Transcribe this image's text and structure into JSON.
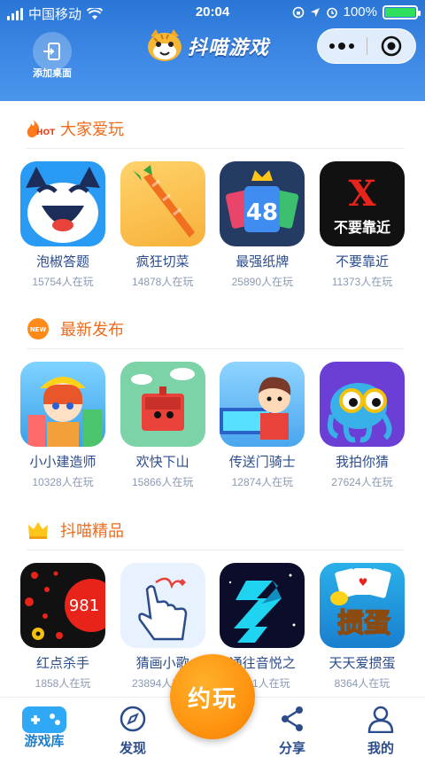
{
  "status_bar": {
    "carrier": "中国移动",
    "time": "20:04",
    "battery": "100%"
  },
  "header": {
    "add_desktop": "添加桌面",
    "brand": "抖喵游戏"
  },
  "sections": [
    {
      "title": "大家爱玩",
      "badge": "HOT",
      "games": [
        {
          "name": "泡椒答题",
          "players": "15754人在玩"
        },
        {
          "name": "疯狂切菜",
          "players": "14878人在玩"
        },
        {
          "name": "最强纸牌",
          "players": "25890人在玩"
        },
        {
          "name": "不要靠近",
          "players": "11373人在玩"
        }
      ]
    },
    {
      "title": "最新发布",
      "badge": "NEW",
      "games": [
        {
          "name": "小小建造师",
          "players": "10328人在玩"
        },
        {
          "name": "欢快下山",
          "players": "15866人在玩"
        },
        {
          "name": "传送门骑士",
          "players": "12874人在玩"
        },
        {
          "name": "我拍你猜",
          "players": "27624人在玩"
        }
      ]
    },
    {
      "title": "抖喵精品",
      "games": [
        {
          "name": "红点杀手",
          "players": "1858人在玩"
        },
        {
          "name": "猜画小歌",
          "players": "23894人在玩"
        },
        {
          "name": "通往音悦之",
          "players": "5981人在玩"
        },
        {
          "name": "天天爱掼蛋",
          "players": "8364人在玩"
        }
      ]
    }
  ],
  "icon_text": {
    "card_num": "48",
    "x_letter": "X",
    "no_near": "不要靠近",
    "red_num": "981",
    "guandan": "掼蛋"
  },
  "tabbar": {
    "tab1": "游戏库",
    "tab2": "发现",
    "fab": "约玩",
    "tab4": "分享",
    "tab5": "我的"
  },
  "colors": {
    "header": "#3f8ae6",
    "accent": "#f06a1a",
    "fab": "#ff9410"
  }
}
